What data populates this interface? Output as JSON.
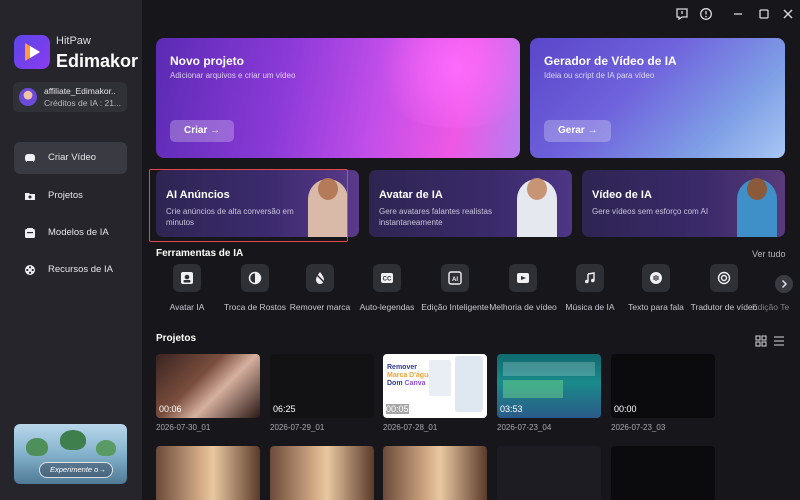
{
  "brand": {
    "line1": "HitPaw",
    "line2": "Edimakor"
  },
  "user": {
    "name": "affiliate_Edimakor..",
    "credits": "Créditos de IA : 21..."
  },
  "nav": [
    {
      "label": "Criar Vídeo",
      "icon": "create-video-icon",
      "active": true
    },
    {
      "label": "Projetos",
      "icon": "folder-icon",
      "active": false
    },
    {
      "label": "Modelos de IA",
      "icon": "template-icon",
      "active": false
    },
    {
      "label": "Recursos de IA",
      "icon": "film-reel-icon",
      "active": false
    }
  ],
  "promo": {
    "button": "Experimente o→"
  },
  "hero": [
    {
      "title": "Novo projeto",
      "subtitle": "Adicionar arquivos e criar um vídeo",
      "button": "Criar →"
    },
    {
      "title": "Gerador de Vídeo de IA",
      "subtitle": "Ideia ou script de IA para vídeo",
      "button": "Gerar →"
    }
  ],
  "features": [
    {
      "title": "AI Anúncios",
      "subtitle": "Crie anúncios de alta conversão em minutos"
    },
    {
      "title": "Avatar de IA",
      "subtitle": "Gere avatares falantes realistas instantaneamente"
    },
    {
      "title": "Vídeo de IA",
      "subtitle": "Gere vídeos sem esforço com AI"
    }
  ],
  "tools_section": {
    "title": "Ferramentas de IA",
    "see_all": "Ver tudo"
  },
  "tools": [
    {
      "label": "Avatar IA",
      "icon": "avatar-icon"
    },
    {
      "label": "Troca de Rostos",
      "icon": "face-swap-icon"
    },
    {
      "label": "Remover marca",
      "icon": "watermark-remove-icon"
    },
    {
      "label": "Auto-legendas",
      "icon": "subtitles-icon"
    },
    {
      "label": "Edição Inteligente",
      "icon": "smart-edit-icon"
    },
    {
      "label": "Melhoria de vídeo",
      "icon": "video-enhance-icon"
    },
    {
      "label": "Música de IA",
      "icon": "music-icon"
    },
    {
      "label": "Texto para fala",
      "icon": "text-to-speech-icon"
    },
    {
      "label": "Tradutor de vídeo",
      "icon": "translate-icon"
    },
    {
      "label": "Edição Te",
      "icon": "text-edit-icon"
    }
  ],
  "projects_section": {
    "title": "Projetos"
  },
  "projects": [
    {
      "name": "2026-07-30_01",
      "duration": "00:06"
    },
    {
      "name": "2026-07-29_01",
      "duration": "06:25"
    },
    {
      "name": "2026-07-28_01",
      "duration": "00:05"
    },
    {
      "name": "2026-07-23_04",
      "duration": "03:53"
    },
    {
      "name": "2026-07-23_03",
      "duration": "00:00"
    }
  ],
  "thumb_texts": {
    "watermark_line1": "Remover",
    "watermark_line2": "Marca D'água",
    "watermark_line3": "Dom",
    "watermark_line4": "Canva"
  },
  "colors": {
    "accent": "#8b3ad8",
    "highlight_border": "#e24848",
    "sidebar": "#25252b",
    "background": "#17171b"
  }
}
